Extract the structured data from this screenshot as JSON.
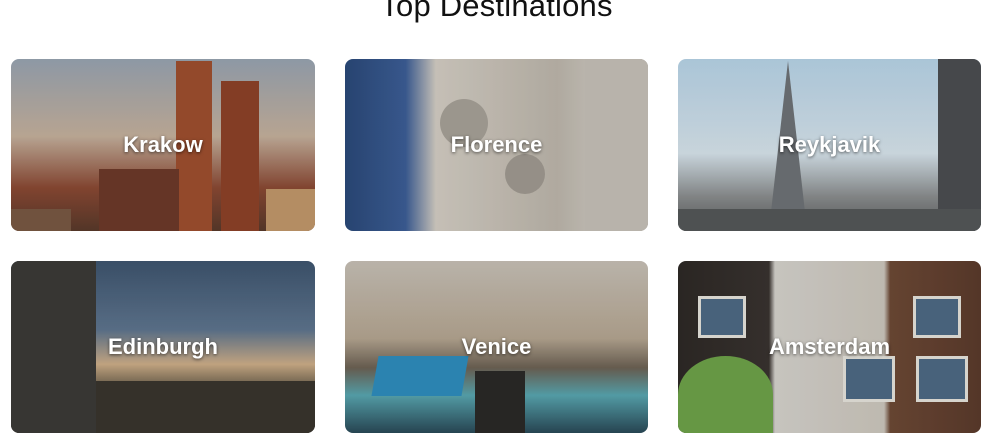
{
  "page": {
    "title": "Top Destinations"
  },
  "destinations": [
    {
      "name": "Krakow"
    },
    {
      "name": "Florence"
    },
    {
      "name": "Reykjavik"
    },
    {
      "name": "Edinburgh"
    },
    {
      "name": "Venice"
    },
    {
      "name": "Amsterdam"
    }
  ]
}
